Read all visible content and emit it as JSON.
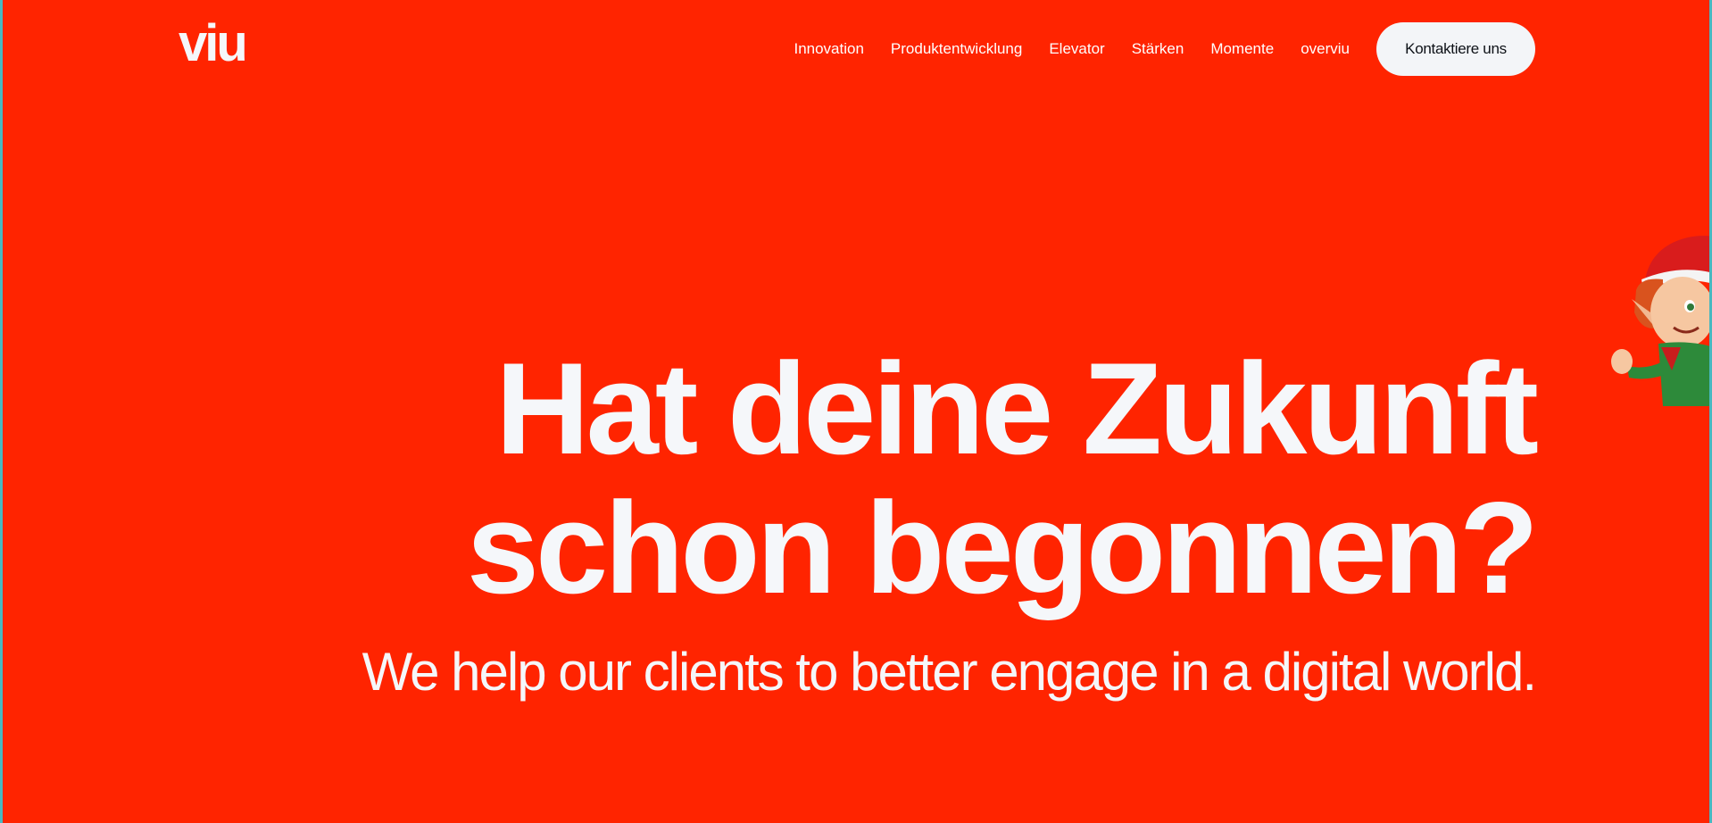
{
  "brand": {
    "logo_text": "viu"
  },
  "nav": {
    "items": [
      {
        "label": "Innovation"
      },
      {
        "label": "Produktentwicklung"
      },
      {
        "label": "Elevator"
      },
      {
        "label": "Stärken"
      },
      {
        "label": "Momente"
      },
      {
        "label": "overviu"
      }
    ],
    "cta_label": "Kontaktiere uns"
  },
  "hero": {
    "headline_line1": "Hat deine Zukunft",
    "headline_line2": "schon begonnen?",
    "subline": "We help our clients to better engage in a digital world."
  },
  "decor": {
    "mascot_icon": "elf-mascot-icon"
  },
  "colors": {
    "background": "#ff2400",
    "text": "#f5f7fa",
    "button_bg": "#f3f5f8",
    "button_text": "#0d1117",
    "frame": "#48b8c0"
  }
}
